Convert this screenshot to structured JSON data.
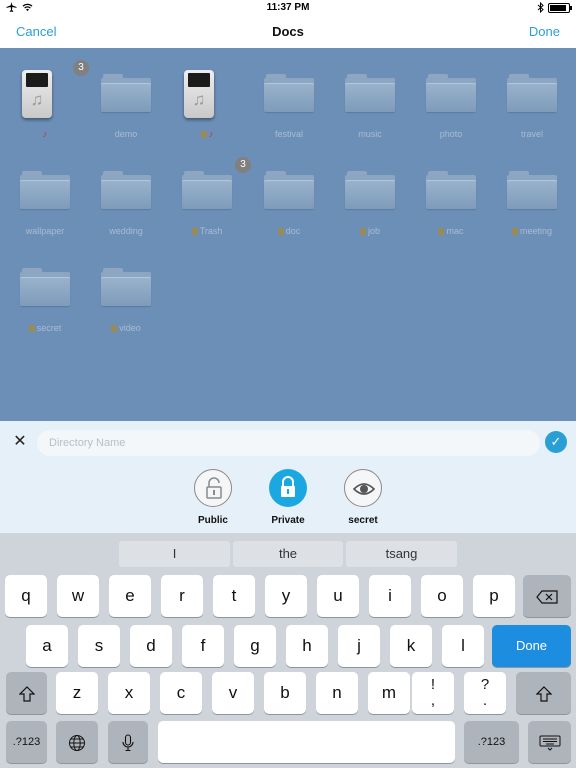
{
  "status_bar": {
    "time": "11:37 PM",
    "airplane_icon": "airplane-icon",
    "wifi_icon": "wifi-icon",
    "bluetooth_icon": "bluetooth-icon",
    "battery_icon": "battery-icon"
  },
  "nav": {
    "cancel": "Cancel",
    "title": "Docs",
    "done": "Done"
  },
  "items": [
    {
      "label": "",
      "kind": "music",
      "badge": "3",
      "glyphs": [
        "guitar"
      ]
    },
    {
      "label": "demo",
      "kind": "folder",
      "badge": "",
      "glyphs": []
    },
    {
      "label": "",
      "kind": "music",
      "badge": "",
      "glyphs": [
        "lock",
        "guitar"
      ]
    },
    {
      "label": "festival",
      "kind": "folder",
      "badge": "",
      "glyphs": []
    },
    {
      "label": "music",
      "kind": "folder",
      "badge": "",
      "glyphs": []
    },
    {
      "label": "photo",
      "kind": "folder",
      "badge": "",
      "glyphs": []
    },
    {
      "label": "travel",
      "kind": "folder",
      "badge": "",
      "glyphs": []
    },
    {
      "label": "wallpaper",
      "kind": "folder",
      "badge": "",
      "glyphs": []
    },
    {
      "label": "wedding",
      "kind": "folder",
      "badge": "",
      "glyphs": []
    },
    {
      "label": "Trash",
      "kind": "folder",
      "badge": "3",
      "glyphs": [
        "lock"
      ]
    },
    {
      "label": "doc",
      "kind": "folder",
      "badge": "",
      "glyphs": [
        "lock"
      ]
    },
    {
      "label": "job",
      "kind": "folder",
      "badge": "",
      "glyphs": [
        "lock"
      ]
    },
    {
      "label": "mac",
      "kind": "folder",
      "badge": "",
      "glyphs": [
        "lock"
      ]
    },
    {
      "label": "meeting",
      "kind": "folder",
      "badge": "",
      "glyphs": [
        "lock"
      ]
    },
    {
      "label": "secret",
      "kind": "folder",
      "badge": "",
      "glyphs": [
        "lock"
      ]
    },
    {
      "label": "video",
      "kind": "folder",
      "badge": "",
      "glyphs": [
        "lock"
      ]
    }
  ],
  "directory": {
    "placeholder": "Directory Name",
    "value": ""
  },
  "options": [
    {
      "label": "Public",
      "icon": "unlocked-icon",
      "selected": false
    },
    {
      "label": "Private",
      "icon": "lock-icon",
      "selected": true
    },
    {
      "label": "secret",
      "icon": "eye-icon",
      "selected": false
    }
  ],
  "keyboard": {
    "suggestions": [
      "I",
      "the",
      "tsang"
    ],
    "row1": [
      "q",
      "w",
      "e",
      "r",
      "t",
      "y",
      "u",
      "i",
      "o",
      "p"
    ],
    "row2": [
      "a",
      "s",
      "d",
      "f",
      "g",
      "h",
      "j",
      "k",
      "l"
    ],
    "row3": [
      "z",
      "x",
      "c",
      "v",
      "b",
      "n",
      "m"
    ],
    "punct1": {
      "top": "!",
      "bottom": ","
    },
    "punct2": {
      "top": "?",
      "bottom": "."
    },
    "done": "Done",
    "numbers": ".?123"
  },
  "colors": {
    "accent": "#2a9fd6",
    "file_area": "#6c8fb8",
    "selected_option": "#1ba8e0",
    "done_key": "#1d8de0"
  }
}
